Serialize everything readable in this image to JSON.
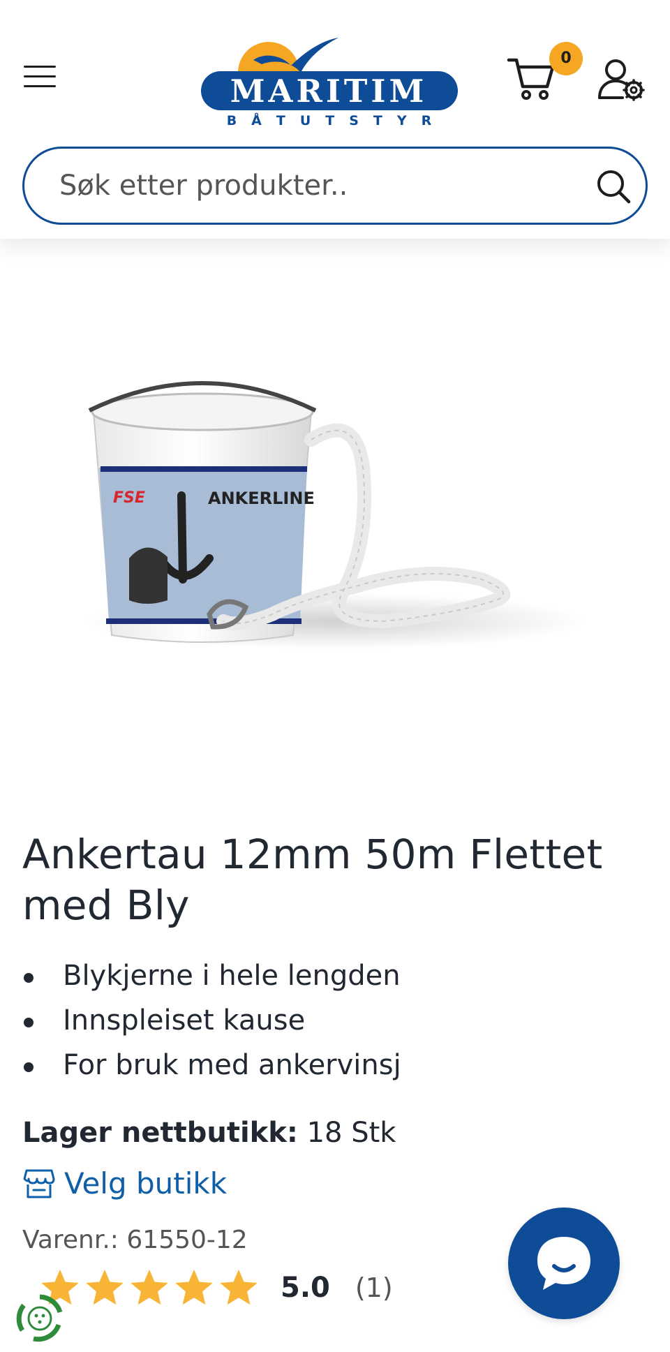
{
  "header": {
    "logo": {
      "word": "MARITIM",
      "sub": "BÅTUTSTYR"
    },
    "cart_count": "0",
    "icons": {
      "menu": "menu-icon",
      "cart": "cart-icon",
      "user": "user-settings-icon",
      "search": "search-icon"
    }
  },
  "search": {
    "placeholder": "Søk etter produkter.."
  },
  "product": {
    "title": "Ankertau 12mm 50m Flettet med Bly",
    "features": [
      "Blykjerne i hele lengden",
      "Innspleiset kause",
      "For bruk med ankervinsj"
    ],
    "image_text": {
      "brand": "FSE",
      "label": "ANKERLINE"
    },
    "stock_label": "Lager nettbutikk:",
    "stock_value": "18 Stk",
    "store_link": "Velg butikk",
    "sku_label": "Varenr.:",
    "sku_value": "61550-12",
    "rating": {
      "value": "5.0",
      "count": "(1)",
      "stars": 5
    }
  },
  "colors": {
    "brand_blue": "#0f4c97",
    "link_blue": "#0f5ea8",
    "badge_orange": "#f5a623",
    "star_yellow": "#f8b535",
    "text_dark": "#222831"
  }
}
